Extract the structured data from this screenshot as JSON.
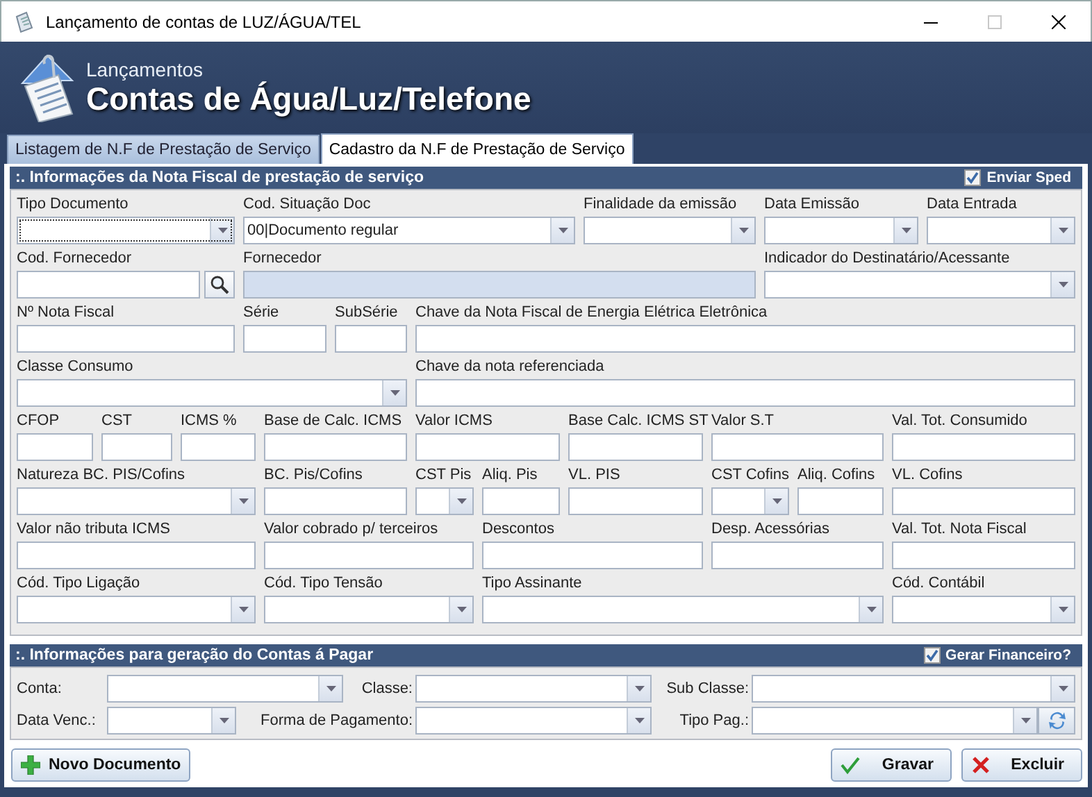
{
  "window": {
    "title": "Lançamento de contas de LUZ/ÁGUA/TEL",
    "maximize_disabled": true
  },
  "header": {
    "subtitle": "Lançamentos",
    "title": "Contas de Água/Luz/Telefone"
  },
  "tabs": [
    {
      "label": "Listagem de N.F de Prestação de Serviço",
      "selected": false
    },
    {
      "label": "Cadastro da N.F de Prestação de Serviço",
      "selected": true
    }
  ],
  "invoice_section": {
    "title": ":. Informações da Nota Fiscal de prestação de serviço",
    "option": {
      "label": "Enviar Sped",
      "checked": true
    },
    "field_lines": [
      [
        {
          "label": "Tipo Documento",
          "kind": "combo",
          "focused": true
        },
        {
          "label": "Cod. Situação Doc",
          "kind": "combo",
          "value": "00|Documento regular"
        },
        {
          "label": "Finalidade da emissão",
          "kind": "combo"
        },
        {
          "label": "Data Emissão",
          "kind": "combo"
        },
        {
          "label": "Data Entrada",
          "kind": "combo"
        }
      ],
      [
        {
          "label": "Cod. Fornecedor",
          "kind": "lookup"
        },
        {
          "label": "Fornecedor",
          "kind": "readonly"
        },
        {
          "label": "Indicador do Destinatário/Acessante",
          "kind": "combo"
        }
      ],
      [
        {
          "label": "Nº Nota Fiscal",
          "kind": "text"
        },
        {
          "label": "Série",
          "kind": "text"
        },
        {
          "label": "SubSérie",
          "kind": "text"
        },
        {
          "label": "Chave da Nota Fiscal de Energia Elétrica Eletrônica",
          "kind": "text"
        }
      ],
      [
        {
          "label": "Classe Consumo",
          "kind": "combo"
        },
        {
          "label": "Chave da nota referenciada",
          "kind": "text"
        }
      ],
      [
        {
          "label": "CFOP",
          "kind": "text"
        },
        {
          "label": "CST",
          "kind": "text"
        },
        {
          "label": "ICMS %",
          "kind": "text"
        },
        {
          "label": "Base de Calc. ICMS",
          "kind": "text"
        },
        {
          "label": "Valor ICMS",
          "kind": "text"
        },
        {
          "label": "Base Calc. ICMS ST",
          "kind": "text"
        },
        {
          "label": "Valor S.T",
          "kind": "text"
        },
        {
          "label": "Val. Tot. Consumido",
          "kind": "text"
        }
      ],
      [
        {
          "label": "Natureza BC. PIS/Cofins",
          "kind": "combo"
        },
        {
          "label": "BC. Pis/Cofins",
          "kind": "text"
        },
        {
          "label": "CST Pis",
          "kind": "combo"
        },
        {
          "label": "Aliq. Pis",
          "kind": "text"
        },
        {
          "label": "VL. PIS",
          "kind": "text"
        },
        {
          "label": "CST Cofins",
          "kind": "combo"
        },
        {
          "label": "Aliq. Cofins",
          "kind": "text"
        },
        {
          "label": "VL. Cofins",
          "kind": "text"
        }
      ],
      [
        {
          "label": "Valor não tributa ICMS",
          "kind": "text"
        },
        {
          "label": "Valor cobrado p/ terceiros",
          "kind": "text"
        },
        {
          "label": "Descontos",
          "kind": "text"
        },
        {
          "label": "Desp. Acessórias",
          "kind": "text"
        },
        {
          "label": "Val. Tot. Nota Fiscal",
          "kind": "text"
        }
      ],
      [
        {
          "label": "Cód. Tipo Ligação",
          "kind": "combo"
        },
        {
          "label": "Cód. Tipo Tensão",
          "kind": "combo"
        },
        {
          "label": "Tipo Assinante",
          "kind": "combo"
        },
        {
          "label": "Cód. Contábil",
          "kind": "combo"
        }
      ]
    ]
  },
  "payable_section": {
    "title": ":. Informações para geração do Contas á Pagar",
    "option": {
      "label": "Gerar Financeiro?",
      "checked": true
    },
    "field_lines": [
      [
        {
          "label": "Conta:",
          "kind": "combo"
        },
        {
          "label": "Classe:",
          "kind": "combo"
        },
        {
          "label": "Sub Classe:",
          "kind": "combo"
        }
      ],
      [
        {
          "label": "Data Venc.:",
          "kind": "combo"
        },
        {
          "label": "Forma de Pagamento:",
          "kind": "combo"
        },
        {
          "label": "Tipo Pag.:",
          "kind": "combo_refresh"
        }
      ]
    ]
  },
  "buttons": [
    {
      "label": "Novo Documento",
      "kind": "new"
    },
    {
      "label": "Gravar",
      "kind": "save"
    },
    {
      "label": "Excluir",
      "kind": "delete"
    }
  ]
}
